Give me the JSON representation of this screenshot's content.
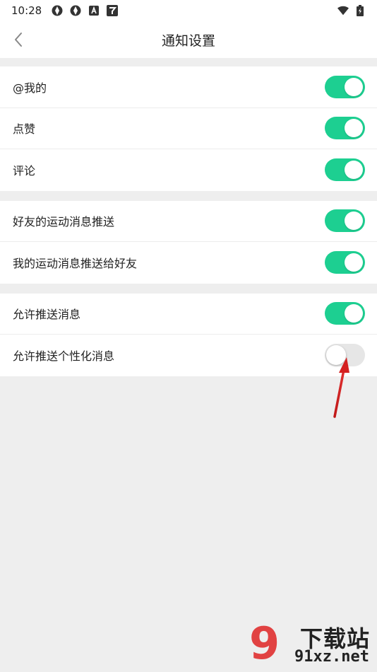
{
  "status_bar": {
    "time": "10:28",
    "icons_left": [
      "aperture-icon",
      "aperture-icon",
      "a-app-icon",
      "app-icon"
    ],
    "icons_right": [
      "wifi-icon",
      "battery-charging-icon"
    ]
  },
  "header": {
    "title": "通知设置"
  },
  "sections": [
    {
      "items": [
        {
          "label": "@我的",
          "enabled": true
        },
        {
          "label": "点赞",
          "enabled": true
        },
        {
          "label": "评论",
          "enabled": true
        }
      ]
    },
    {
      "items": [
        {
          "label": "好友的运动消息推送",
          "enabled": true
        },
        {
          "label": "我的运动消息推送给好友",
          "enabled": true
        }
      ]
    },
    {
      "items": [
        {
          "label": "允许推送消息",
          "enabled": true
        },
        {
          "label": "允许推送个性化消息",
          "enabled": false
        }
      ]
    }
  ],
  "colors": {
    "toggle_on": "#1dcf91",
    "toggle_off": "#e6e6e6",
    "annotation_arrow": "#d42020"
  },
  "watermark": {
    "logo_text": "9",
    "top_text": "下载站",
    "bottom_text": "91xz.net"
  }
}
